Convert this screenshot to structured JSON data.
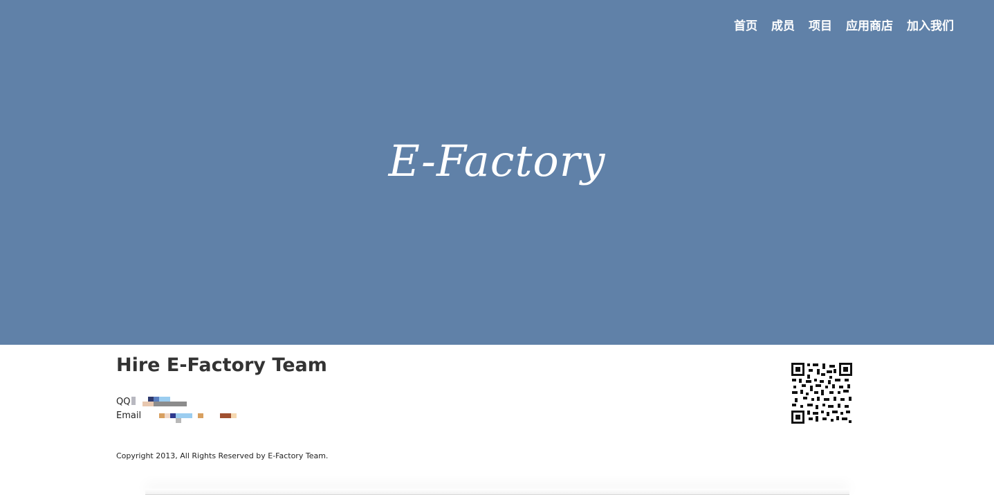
{
  "nav": {
    "items": [
      {
        "label": "首页"
      },
      {
        "label": "成员"
      },
      {
        "label": "项目"
      },
      {
        "label": "应用商店"
      },
      {
        "label": "加入我们"
      }
    ]
  },
  "hero": {
    "brand": "E-Factory",
    "background_color": "#6081a8"
  },
  "hire": {
    "title": "Hire E-Factory Team",
    "qq_label": "QQ",
    "email_label": "Email"
  },
  "footer": {
    "copyright": "Copyright 2013, All Rights Reserved by E-Factory Team."
  },
  "qr_code": {
    "icon": "qr-code-icon"
  }
}
